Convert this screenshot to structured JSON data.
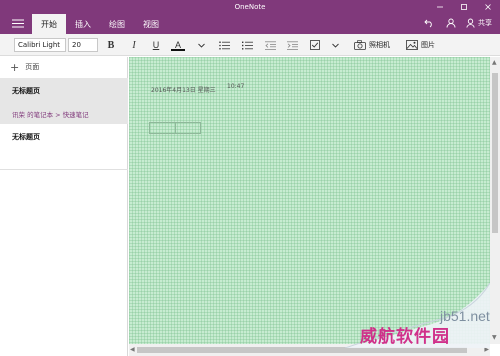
{
  "app": {
    "title": "OneNote"
  },
  "window_controls": {
    "minimize": "minimize",
    "maximize": "maximize",
    "close": "close"
  },
  "ribbon": {
    "tabs": [
      {
        "label": "开始",
        "active": true
      },
      {
        "label": "插入",
        "active": false
      },
      {
        "label": "绘图",
        "active": false
      },
      {
        "label": "视图",
        "active": false
      }
    ],
    "share_label": "共享"
  },
  "toolbar": {
    "font_name": "Calibri Light",
    "font_size": "20",
    "bold": "B",
    "italic": "I",
    "underline": "U",
    "font_color": "A",
    "camera_label": "照相机",
    "picture_label": "图片"
  },
  "sidebar": {
    "add_page_label": "页面",
    "pages": [
      {
        "title": "无标题页",
        "path": "讯荣 的笔记本 > 快速笔记",
        "selected": true
      },
      {
        "title": "无标题页",
        "path": "",
        "selected": false
      }
    ]
  },
  "note": {
    "date": "2016年4月13日 星期三",
    "time": "10:47"
  },
  "watermark": {
    "line1": "jb51.net",
    "line2": "威航软件园"
  },
  "colors": {
    "accent": "#80397b",
    "canvas": "#c7ecd1"
  }
}
